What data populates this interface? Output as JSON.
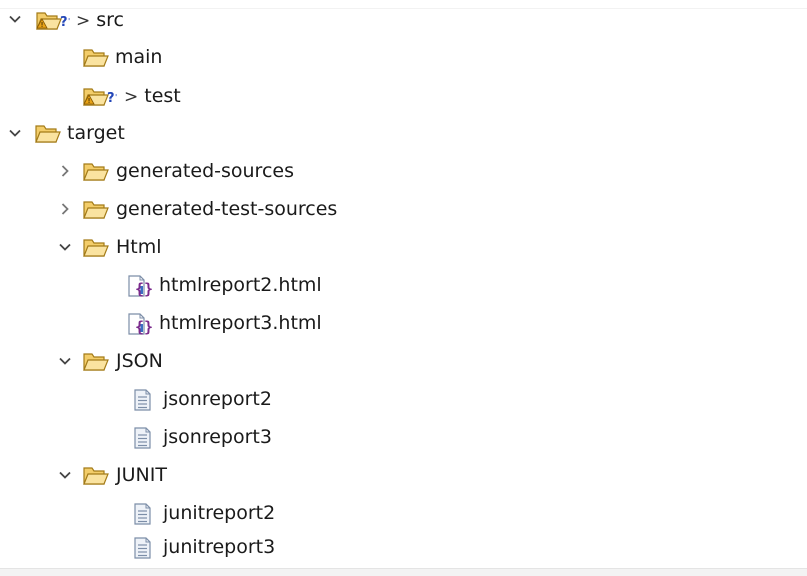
{
  "tree": {
    "nodes": [
      {
        "name": "src",
        "decoration": ">",
        "icon": "warning-unknown-folder-icon",
        "state": "expanded"
      },
      {
        "name": "main",
        "icon": "folder-open-icon",
        "state": "leaf"
      },
      {
        "name": "test",
        "decoration": ">",
        "icon": "warning-unknown-folder-icon",
        "state": "leaf"
      },
      {
        "name": "target",
        "icon": "folder-open-icon",
        "state": "expanded"
      },
      {
        "name": "generated-sources",
        "icon": "folder-open-icon",
        "state": "collapsed"
      },
      {
        "name": "generated-test-sources",
        "icon": "folder-open-icon",
        "state": "collapsed"
      },
      {
        "name": "Html",
        "icon": "folder-open-icon",
        "state": "expanded"
      },
      {
        "name": "htmlreport2.html",
        "icon": "html-file-icon",
        "state": "leaf"
      },
      {
        "name": "htmlreport3.html",
        "icon": "html-file-icon",
        "state": "leaf"
      },
      {
        "name": "JSON",
        "icon": "folder-open-icon",
        "state": "expanded"
      },
      {
        "name": "jsonreport2",
        "icon": "text-file-icon",
        "state": "leaf"
      },
      {
        "name": "jsonreport3",
        "icon": "text-file-icon",
        "state": "leaf"
      },
      {
        "name": "JUNIT",
        "icon": "folder-open-icon",
        "state": "expanded"
      },
      {
        "name": "junitreport2",
        "icon": "text-file-icon",
        "state": "leaf"
      },
      {
        "name": "junitreport3",
        "icon": "text-file-icon",
        "state": "leaf"
      }
    ]
  },
  "colors": {
    "folder_fill": "#f3cd6a",
    "folder_stroke": "#a37b18",
    "chevron": "#444444",
    "warning": "#e8a317",
    "question": "#2346b8",
    "html_brace": "#7a2a8c",
    "file_stroke": "#7c8ea8"
  }
}
